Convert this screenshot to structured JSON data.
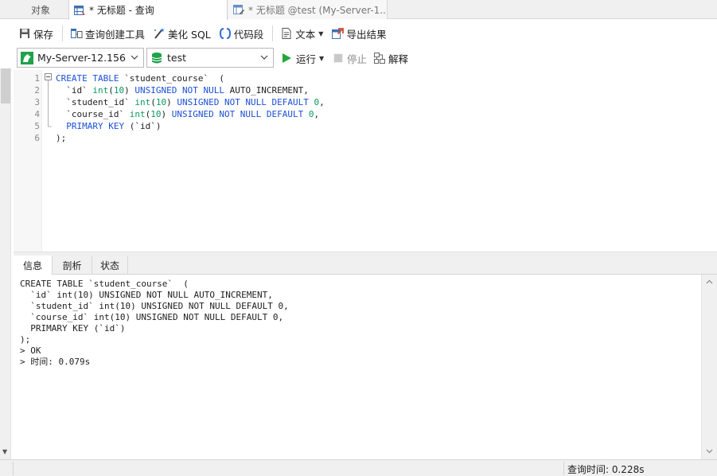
{
  "tabs": {
    "objects": "对象",
    "active": "* 无标题 - 查询",
    "inactive": "* 无标题 @test (My-Server-1..."
  },
  "toolbar": {
    "save": "保存",
    "query_builder": "查询创建工具",
    "beautify": "美化 SQL",
    "snippet": "代码段",
    "text": "文本",
    "export": "导出结果"
  },
  "connection": {
    "server": "My-Server-12.156",
    "database": "test",
    "run": "运行",
    "stop": "停止",
    "explain": "解释"
  },
  "editor": {
    "line_numbers": [
      "1",
      "2",
      "3",
      "4",
      "5",
      "6"
    ],
    "code": {
      "l1_kw": "CREATE TABLE",
      "l1_rest": " `student_course`  (",
      "l2_a": "  `id` ",
      "l2_int": "int",
      "l2_p1": "(",
      "l2_num": "10",
      "l2_p2": ") ",
      "l2_kw": "UNSIGNED NOT NULL",
      "l2_rest": " AUTO_INCREMENT,",
      "l3_a": "  `student_id` ",
      "l3_int": "int",
      "l3_p1": "(",
      "l3_num": "10",
      "l3_p2": ") ",
      "l3_kw": "UNSIGNED NOT NULL DEFAULT",
      "l3_sp": " ",
      "l3_num2": "0",
      "l3_rest": ",",
      "l4_a": "  `course_id` ",
      "l4_int": "int",
      "l4_p1": "(",
      "l4_num": "10",
      "l4_p2": ") ",
      "l4_kw": "UNSIGNED NOT NULL DEFAULT",
      "l4_sp": " ",
      "l4_num2": "0",
      "l4_rest": ",",
      "l5_kw": "  PRIMARY KEY",
      "l5_rest": " (`id`)",
      "l6": ");"
    }
  },
  "result_tabs": [
    "信息",
    "剖析",
    "状态"
  ],
  "output_lines": [
    "CREATE TABLE `student_course`  (",
    "  `id` int(10) UNSIGNED NOT NULL AUTO_INCREMENT,",
    "  `student_id` int(10) UNSIGNED NOT NULL DEFAULT 0,",
    "  `course_id` int(10) UNSIGNED NOT NULL DEFAULT 0,",
    "  PRIMARY KEY (`id`)",
    ");",
    "> OK",
    "> 时间: 0.079s"
  ],
  "status": {
    "query_time": "查询时间: 0.228s"
  },
  "colors": {
    "keyword": "#1a4fd6",
    "number": "#0a9a5e",
    "run_green": "#22a83a"
  }
}
